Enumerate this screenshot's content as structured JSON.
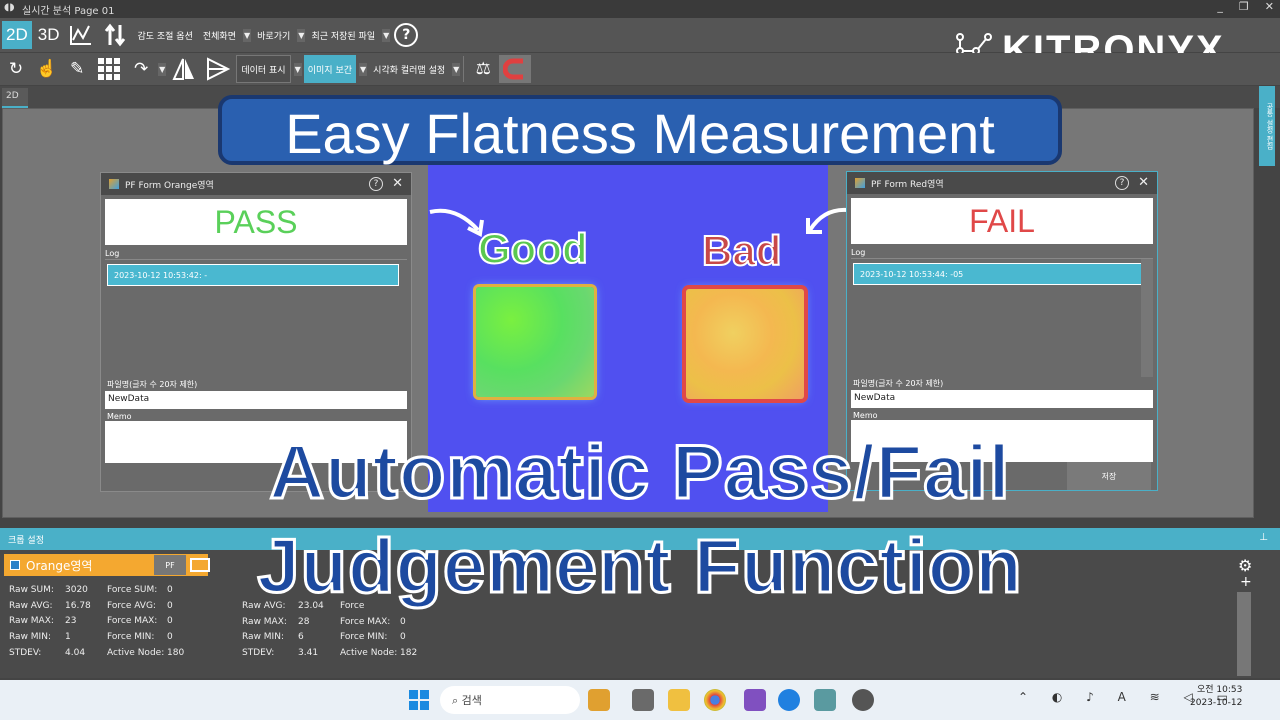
{
  "window": {
    "title": "실시간 분석 Page 01",
    "icon": "app-icon",
    "controls": [
      "_",
      "❐",
      "✕"
    ]
  },
  "toolbar1": {
    "view_2d": "2D",
    "view_3d": "3D",
    "sensitivity": "감도 조절 옵션",
    "fullscreen": "전체화면",
    "shortcut": "바로가기",
    "recent_files": "최근 저장된 파일",
    "help": "?"
  },
  "toolbar2": {
    "data_display": "데이터 표시",
    "image_interp": "이미지 보간",
    "color_map": "시각화 컬러맵 설정"
  },
  "logo": {
    "text": "KITRONYX"
  },
  "tab": {
    "label": "2D"
  },
  "rightrail": {
    "text": "공통 설정 편집"
  },
  "headline": "Easy Flatness Measurement",
  "sensor": {
    "good_label": "Good",
    "bad_label": "Bad"
  },
  "pf_left": {
    "title": "PF Form Orange영역",
    "result": "PASS",
    "result_color": "#5ad05a",
    "log_label": "Log",
    "log_entry": "2023-10-12 10:53:42: -",
    "filename_label": "파일명(글자 수 20자 제한)",
    "filename": "NewData",
    "memo_label": "Memo"
  },
  "pf_right": {
    "title": "PF Form Red영역",
    "result": "FAIL",
    "result_color": "#e04848",
    "log_label": "Log",
    "log_entry": "2023-10-12 10:53:44: -05",
    "filename_label": "파일명(글자 수 20자 제한)",
    "filename": "NewData",
    "memo_label": "Memo",
    "save": "저장"
  },
  "caption": {
    "line1": "Automatic Pass/Fail",
    "line2": "Judgement Function"
  },
  "bottom": {
    "header": "크롭 설정",
    "region": "Orange영역",
    "pf_button": "PF",
    "stats_left": [
      {
        "k": "Raw SUM:",
        "v": "3020",
        "k2": "Force SUM:",
        "v2": "0"
      },
      {
        "k": "Raw AVG:",
        "v": "16.78",
        "k2": "Force AVG:",
        "v2": "0"
      },
      {
        "k": "Raw MAX:",
        "v": "23",
        "k2": "Force MAX:",
        "v2": "0"
      },
      {
        "k": "Raw MIN:",
        "v": "1",
        "k2": "Force MIN:",
        "v2": "0"
      },
      {
        "k": "STDEV:",
        "v": "4.04",
        "k2": "Active Node:",
        "v2": "180"
      }
    ],
    "stats_right": [
      {
        "k": "Raw AVG:",
        "v": "23.04",
        "k2": "Force",
        "v2": ""
      },
      {
        "k": "Raw MAX:",
        "v": "28",
        "k2": "Force MAX:",
        "v2": "0"
      },
      {
        "k": "Raw MIN:",
        "v": "6",
        "k2": "Force MIN:",
        "v2": "0"
      },
      {
        "k": "STDEV:",
        "v": "3.41",
        "k2": "Active Node:",
        "v2": "182"
      }
    ]
  },
  "taskbar": {
    "search_placeholder": "검색",
    "time": "오전 10:53",
    "date": "2023-10-12"
  }
}
